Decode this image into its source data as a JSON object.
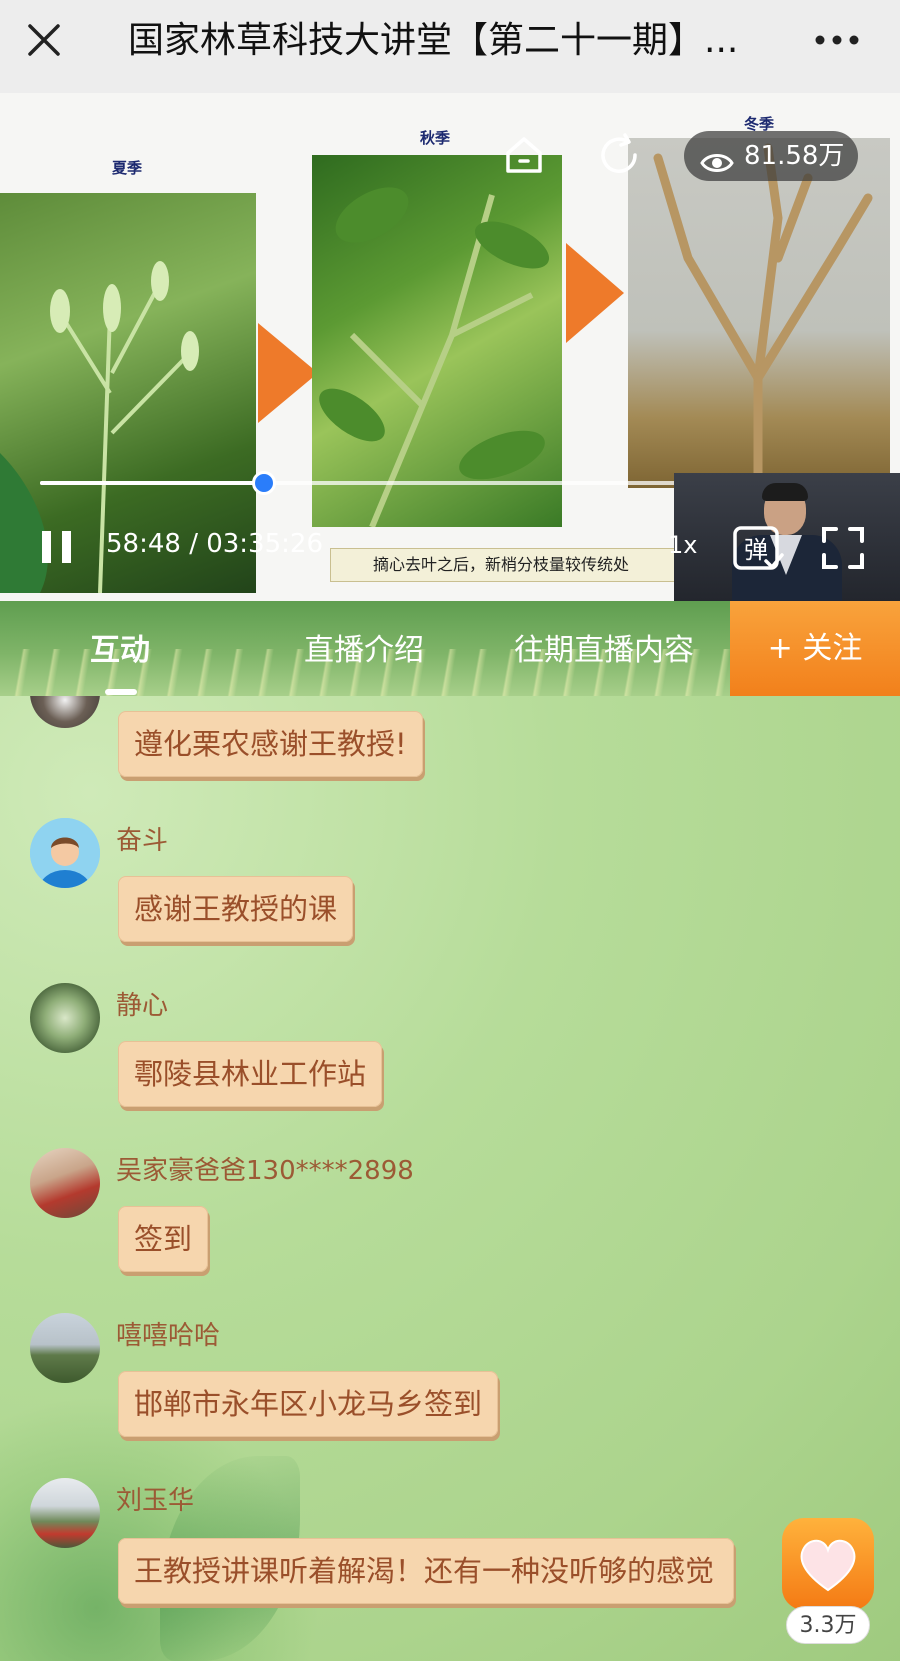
{
  "header": {
    "title": "国家林草科技大讲堂【第二十一期】...",
    "close_icon": "close-icon",
    "more_icon": "more-dots-icon"
  },
  "video": {
    "slide_labels": [
      "夏季",
      "秋季",
      "冬季"
    ],
    "slide_caption": "摘心去叶之后，新梢分枝量较传统处",
    "views": "81.58万",
    "current_time": "58:48",
    "duration": "03:35:26",
    "time_display": "58:48 / 03:35:26",
    "progress": 0.273,
    "speed": "1x",
    "danmu_label": "弹",
    "accent_color": "#2a7dfa"
  },
  "tabs": [
    {
      "label": "互动",
      "active": true
    },
    {
      "label": "直播介绍",
      "active": false
    },
    {
      "label": "往期直播内容",
      "active": false
    }
  ],
  "follow_label": "+ 关注",
  "messages": [
    {
      "user": "",
      "text": "遵化栗农感谢王教授!"
    },
    {
      "user": "奋斗",
      "text": "感谢王教授的课"
    },
    {
      "user": "静心",
      "text": "鄠陵县林业工作站"
    },
    {
      "user": "吴家豪爸爸130****2898",
      "text": "签到"
    },
    {
      "user": "嘻嘻哈哈",
      "text": "邯郸市永年区小龙马乡签到"
    },
    {
      "user": "刘玉华",
      "text": "王教授讲课听着解渴！还有一种没听够的感觉"
    }
  ],
  "likes": "3.3万",
  "colors": {
    "bubble": "#f6d6ae",
    "bubble_text": "#9a4f2a",
    "username": "#9c5a35",
    "follow": "#f2801b"
  }
}
